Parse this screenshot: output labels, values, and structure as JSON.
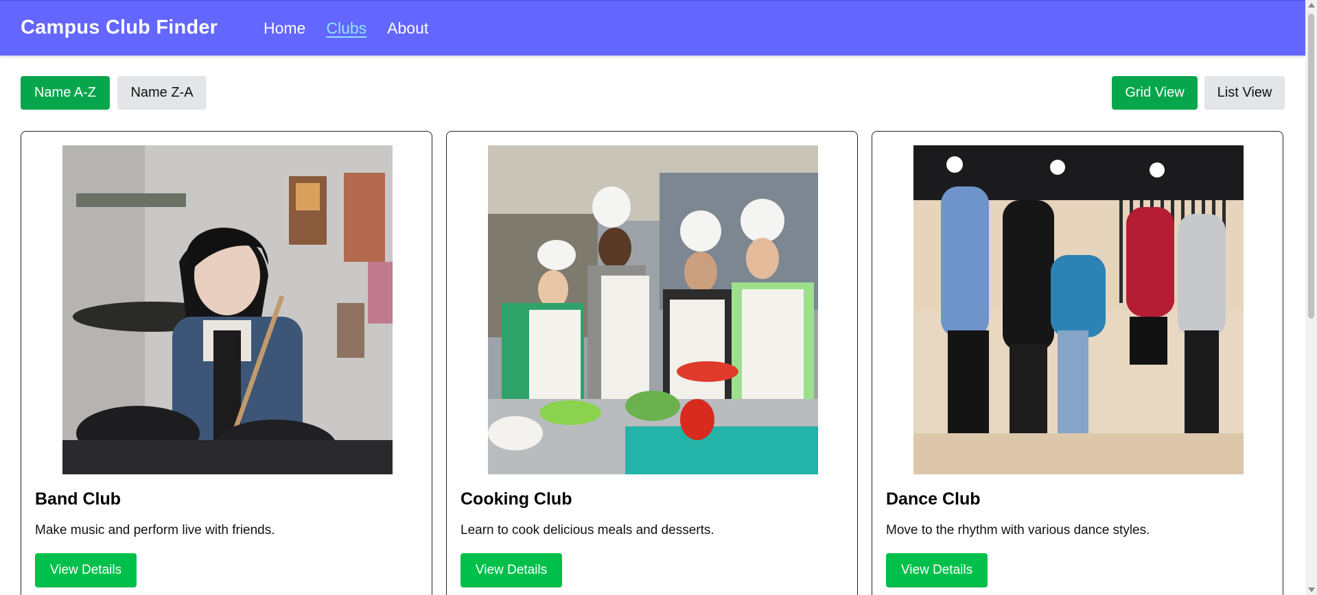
{
  "navbar": {
    "brand": "Campus Club Finder",
    "links": [
      {
        "label": "Home"
      },
      {
        "label": "Clubs",
        "active": true
      },
      {
        "label": "About"
      }
    ],
    "bg_color": "#6366ff",
    "active_link_color": "#8fe7ff"
  },
  "sort": {
    "az_label": "Name A-Z",
    "za_label": "Name Z-A",
    "active": "Name A-Z"
  },
  "view": {
    "grid_label": "Grid View",
    "list_label": "List View",
    "active": "Grid View"
  },
  "clubs": [
    {
      "title": "Band Club",
      "description": "Make music and perform live with friends.",
      "button": "View Details",
      "image": "drummer-photo"
    },
    {
      "title": "Cooking Club",
      "description": "Learn to cook delicious meals and desserts.",
      "button": "View Details",
      "image": "chefs-kitchen-photo"
    },
    {
      "title": "Dance Club",
      "description": "Move to the rhythm with various dance styles.",
      "button": "View Details",
      "image": "dance-group-photo"
    }
  ],
  "colors": {
    "primary_button": "#07a64c",
    "card_button": "#00c04b",
    "secondary_button": "#e4e5e8"
  }
}
